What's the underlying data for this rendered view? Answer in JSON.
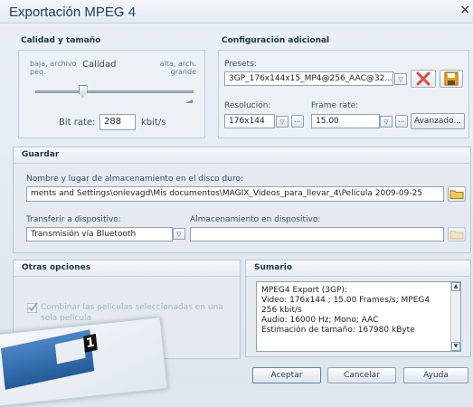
{
  "window": {
    "title": "Exportación MPEG 4",
    "close_glyph": "×"
  },
  "calidad": {
    "header": "Calidad y tamaño",
    "low_label": "baja, archivo pequeño",
    "low_line1": "baja, archivo",
    "low_line2": "peq.",
    "mid_label": "Calidad",
    "high_line1": "alta, arch.",
    "high_line2": "grande",
    "quality_level": 0.3,
    "bitrate_label": "Bit rate:",
    "bitrate_value": "288",
    "bitrate_unit": "kbit/s"
  },
  "config": {
    "header": "Configuración adicional",
    "presets_label": "Presets:",
    "preset_value": "3GP_176x144x15_MP4@256_AAC@32...",
    "resolution_label": "Resolución:",
    "resolution_value": "176x144",
    "framerate_label": "Frame rate:",
    "framerate_value": "15.00",
    "ellipsis": "...",
    "advanced_button": "Avanzado..."
  },
  "guardar": {
    "header": "Guardar",
    "path_label": "Nombre y lugar de almacenamiento en el disco duro:",
    "path_value": "ments and Settings\\onievagd\\Mis documentos\\MAGIX_Videos_para_llevar_4\\Película 2009-09-25",
    "transfer_label": "Transferir a dispositivo:",
    "transfer_value": "Transmisión vía Bluetooth",
    "device_storage_label": "Almacenamiento en dispositivo:",
    "device_storage_value": ""
  },
  "otras": {
    "header": "Otras opciones",
    "combine_label_line1": "Combinar las películas seleccionadas en una",
    "combine_label_line2": "sola película",
    "combine_checked": true
  },
  "resumen": {
    "header": "Sumario",
    "lines": [
      "MPEG4 Export (3GP):",
      "Video: 176x144 ; 15.00 Frames/s; MPEG4",
      "256 kbit/s",
      "Audio: 16000 Hz; Mono;  AAC",
      "Estimación de tamaño: 167980 kByte"
    ]
  },
  "footer": {
    "accept": "Aceptar",
    "cancel": "Cancelar",
    "help": "Ayuda"
  },
  "packaging": {
    "number": "1"
  },
  "colors": {
    "title": "#1c3f66",
    "delete_icon": "#e04a3c",
    "save_icon": "#e7a21a"
  }
}
